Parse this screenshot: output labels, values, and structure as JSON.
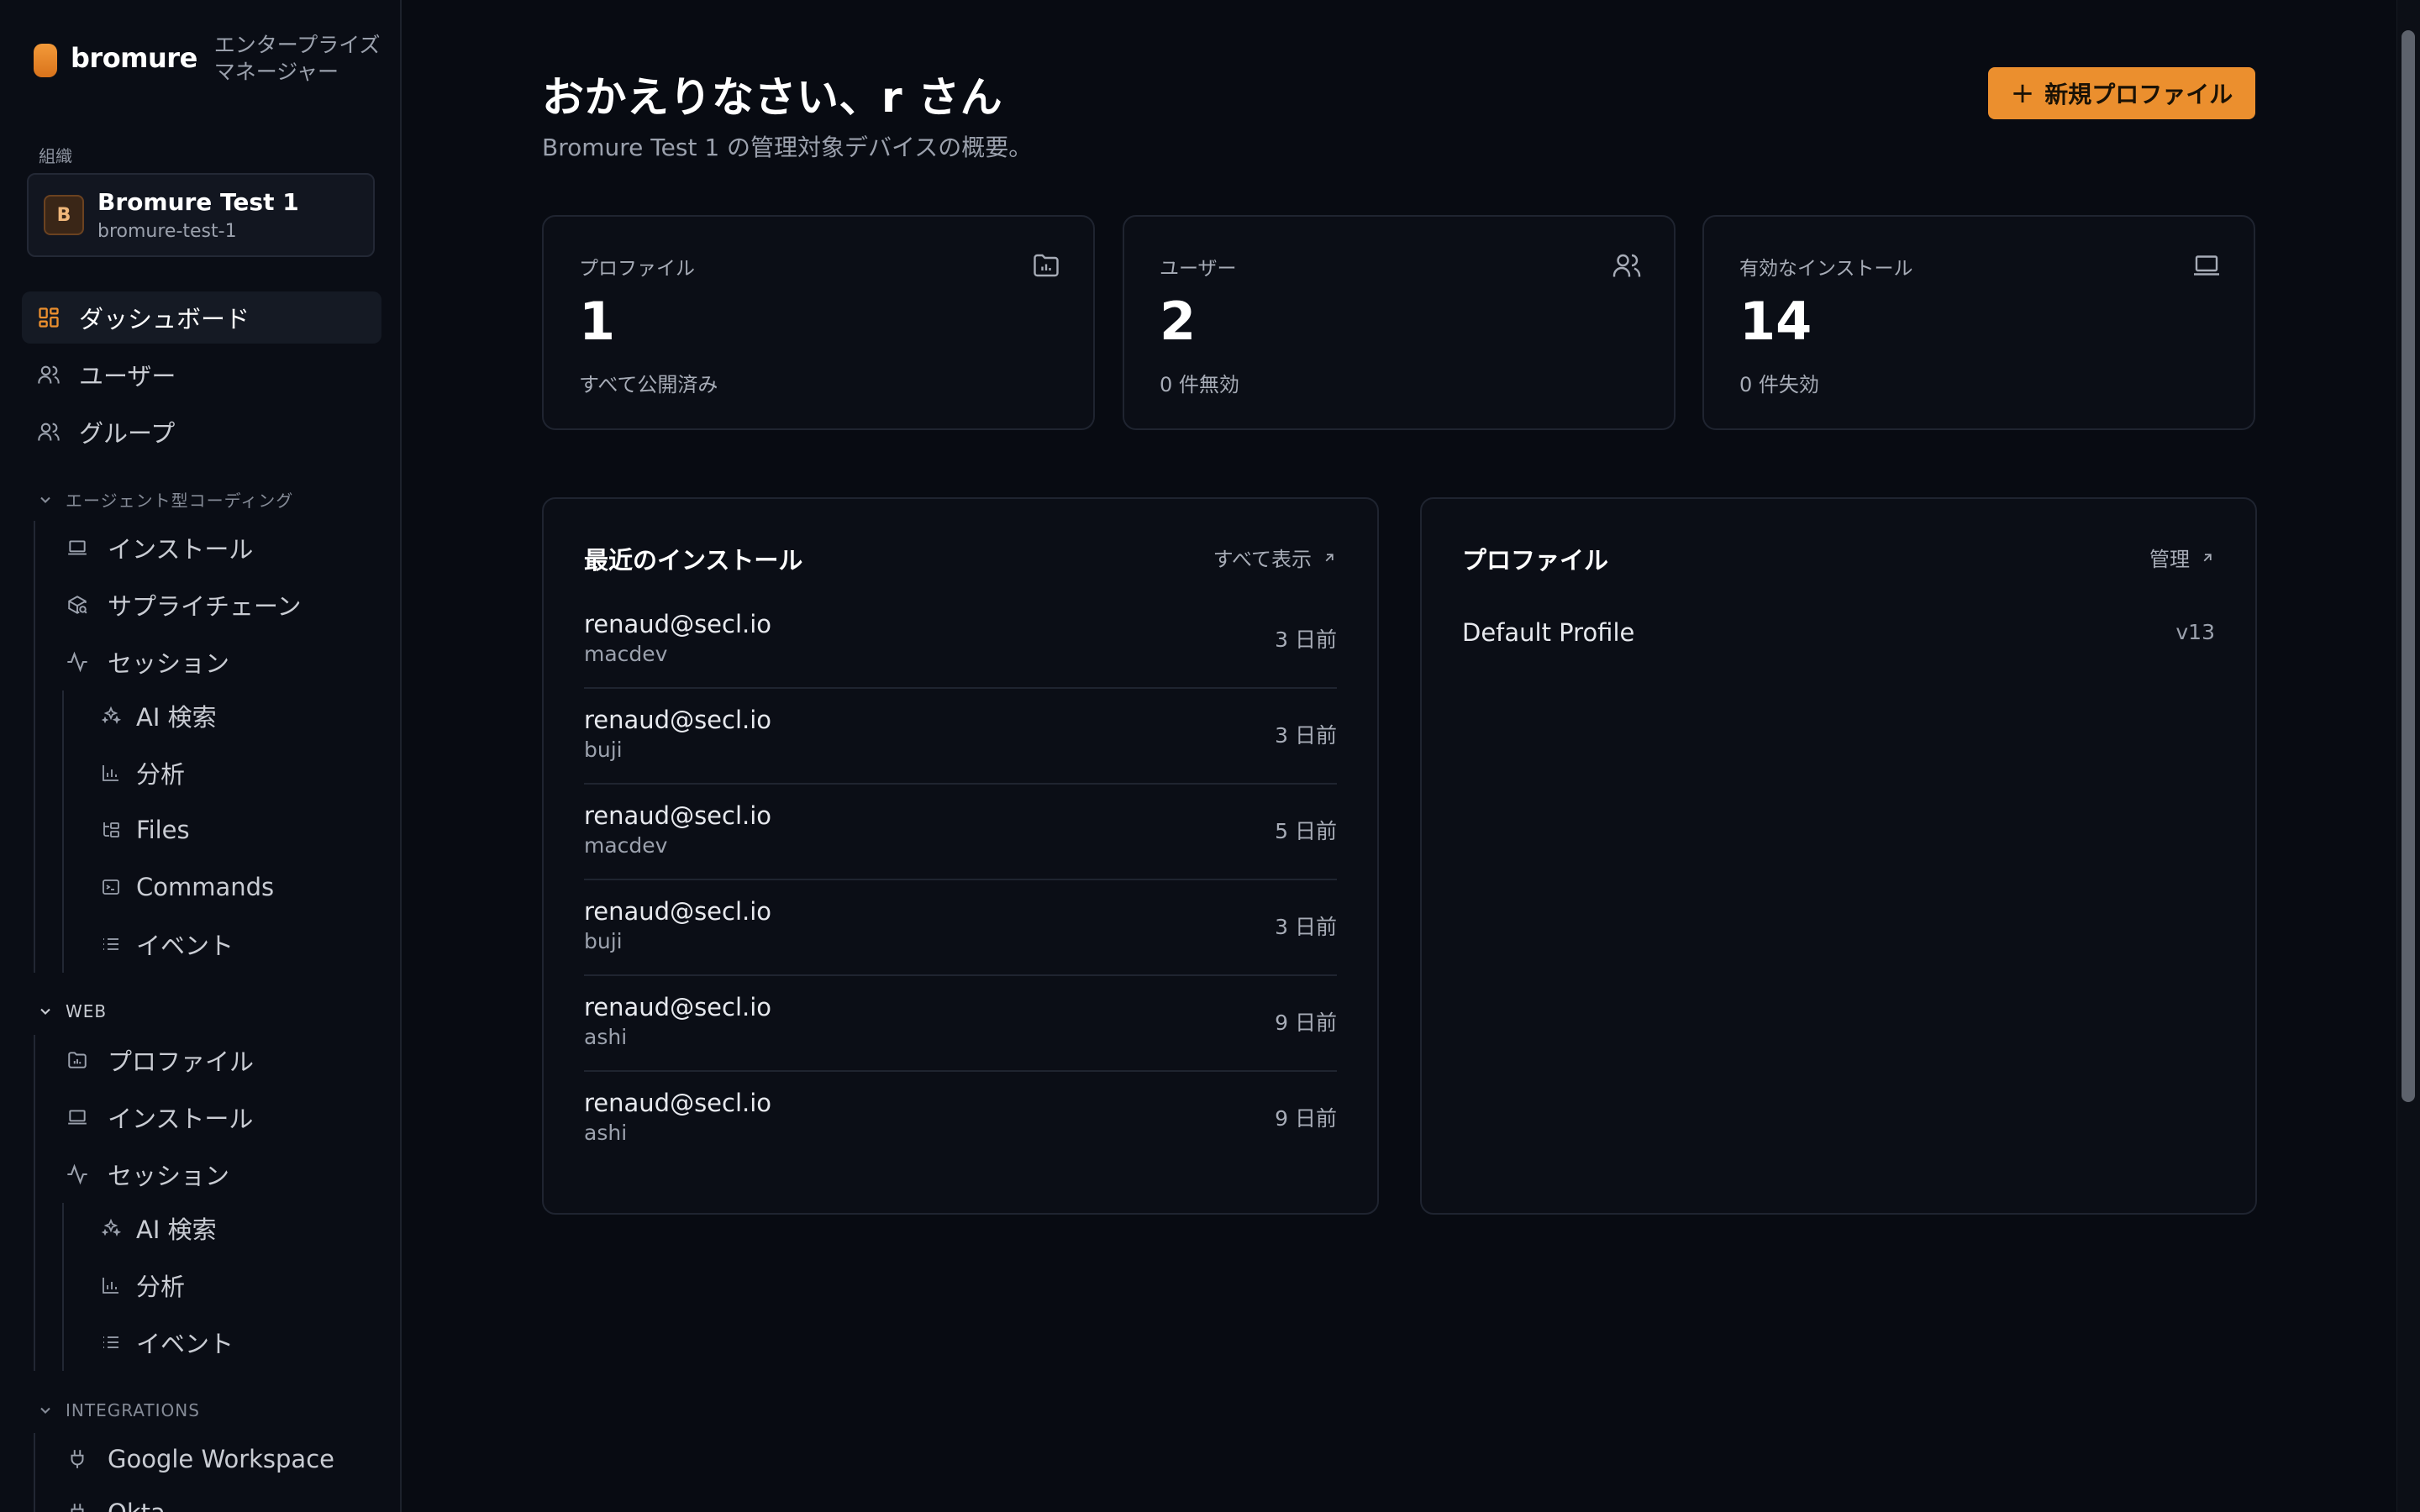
{
  "sidebar": {
    "brand": {
      "name": "bromure",
      "subtitle": "エンタープライズマネージャー"
    },
    "org": {
      "label": "組織",
      "avatar_letter": "B",
      "name": "Bromure Test 1",
      "slug": "bromure-test-1"
    },
    "top_items": [
      {
        "label": "ダッシュボード",
        "icon": "dashboard-grid-icon",
        "active": true
      },
      {
        "label": "ユーザー",
        "icon": "users-icon"
      },
      {
        "label": "グループ",
        "icon": "group-icon"
      }
    ],
    "sections": [
      {
        "title": "エージェント型コーディング",
        "items": [
          {
            "label": "インストール",
            "icon": "laptop-icon"
          },
          {
            "label": "サプライチェーン",
            "icon": "package-search-icon"
          },
          {
            "label": "セッション",
            "icon": "activity-icon"
          }
        ],
        "sub_items": [
          {
            "label": "AI 検索",
            "icon": "sparkles-icon"
          },
          {
            "label": "分析",
            "icon": "bar-chart-icon"
          },
          {
            "label": "Files",
            "icon": "folder-tree-icon"
          },
          {
            "label": "Commands",
            "icon": "terminal-icon"
          },
          {
            "label": "イベント",
            "icon": "list-icon"
          }
        ]
      },
      {
        "title": "WEB",
        "items": [
          {
            "label": "プロファイル",
            "icon": "folder-chart-icon"
          },
          {
            "label": "インストール",
            "icon": "laptop-icon"
          },
          {
            "label": "セッション",
            "icon": "activity-icon"
          }
        ],
        "sub_items": [
          {
            "label": "AI 検索",
            "icon": "sparkles-icon"
          },
          {
            "label": "分析",
            "icon": "bar-chart-icon"
          },
          {
            "label": "イベント",
            "icon": "list-icon"
          }
        ]
      },
      {
        "title": "INTEGRATIONS",
        "items": [
          {
            "label": "Google Workspace",
            "icon": "plug-icon"
          },
          {
            "label": "Okta",
            "icon": "plug-icon"
          }
        ]
      }
    ]
  },
  "header": {
    "title": "おかえりなさい、r さん",
    "subtitle": "Bromure Test 1 の管理対象デバイスの概要。",
    "new_profile_button": "新規プロファイル"
  },
  "stats": [
    {
      "label": "プロファイル",
      "value": "1",
      "note": "すべて公開済み",
      "icon": "folder-chart-icon"
    },
    {
      "label": "ユーザー",
      "value": "2",
      "note": "0 件無効",
      "icon": "users-icon"
    },
    {
      "label": "有効なインストール",
      "value": "14",
      "note": "0 件失効",
      "icon": "laptop-icon"
    }
  ],
  "recent_installs": {
    "title": "最近のインストール",
    "link": "すべて表示",
    "rows": [
      {
        "email": "renaud@secl.io",
        "host": "macdev",
        "time": "3 日前"
      },
      {
        "email": "renaud@secl.io",
        "host": "buji",
        "time": "3 日前"
      },
      {
        "email": "renaud@secl.io",
        "host": "macdev",
        "time": "5 日前"
      },
      {
        "email": "renaud@secl.io",
        "host": "buji",
        "time": "3 日前"
      },
      {
        "email": "renaud@secl.io",
        "host": "ashi",
        "time": "9 日前"
      },
      {
        "email": "renaud@secl.io",
        "host": "ashi",
        "time": "9 日前"
      }
    ]
  },
  "profiles": {
    "title": "プロファイル",
    "link": "管理",
    "rows": [
      {
        "name": "Default Profile",
        "version": "v13"
      }
    ]
  },
  "colors": {
    "accent": "#eb8f2e",
    "background": "#080b12",
    "card": "#0b0e16",
    "border": "#1f2430"
  }
}
